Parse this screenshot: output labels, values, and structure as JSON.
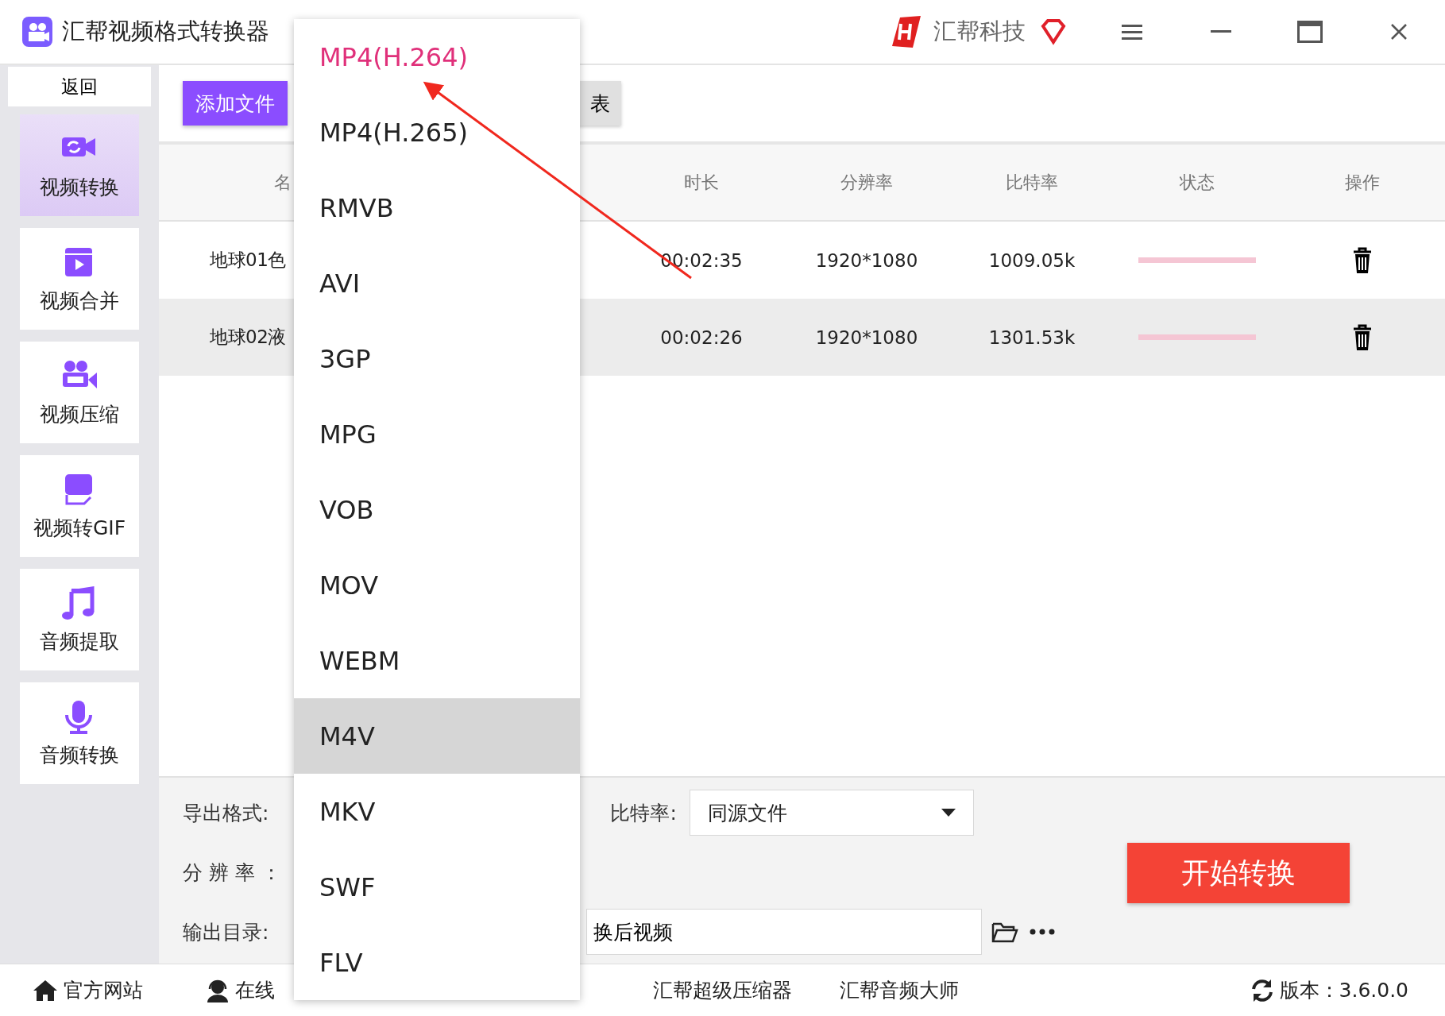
{
  "window": {
    "title": "汇帮视频格式转换器",
    "brand": "汇帮科技"
  },
  "sidebar": {
    "back": "返回",
    "items": [
      {
        "label": "视频转换",
        "selected": true
      },
      {
        "label": "视频合并",
        "selected": false
      },
      {
        "label": "视频压缩",
        "selected": false
      },
      {
        "label": "视频转GIF",
        "selected": false
      },
      {
        "label": "音频提取",
        "selected": false
      },
      {
        "label": "音频转换",
        "selected": false
      }
    ]
  },
  "toolbar": {
    "add_file": "添加文件",
    "list_button": "表"
  },
  "table": {
    "columns": [
      "名",
      "时长",
      "分辨率",
      "比特率",
      "状态",
      "操作"
    ],
    "rows": [
      {
        "name": "地球01色",
        "duration": "00:02:35",
        "resolution": "1920*1080",
        "bitrate": "1009.05k",
        "selected": false
      },
      {
        "name": "地球02液",
        "duration": "00:02:26",
        "resolution": "1920*1080",
        "bitrate": "1301.53k",
        "selected": true
      }
    ]
  },
  "settings": {
    "format_label": "导出格式:",
    "bitrate_label": "比特率:",
    "bitrate_value": "同源文件",
    "resolution_label": "分 辨 率 ：",
    "output_label": "输出目录:",
    "output_value": "换后视频",
    "start": "开始转换"
  },
  "format_menu": [
    {
      "label": "MP4(H.264)",
      "selected": true,
      "hovered": false
    },
    {
      "label": "MP4(H.265)",
      "selected": false,
      "hovered": false
    },
    {
      "label": "RMVB",
      "selected": false,
      "hovered": false
    },
    {
      "label": "AVI",
      "selected": false,
      "hovered": false
    },
    {
      "label": "3GP",
      "selected": false,
      "hovered": false
    },
    {
      "label": "MPG",
      "selected": false,
      "hovered": false
    },
    {
      "label": "VOB",
      "selected": false,
      "hovered": false
    },
    {
      "label": "MOV",
      "selected": false,
      "hovered": false
    },
    {
      "label": "WEBM",
      "selected": false,
      "hovered": false
    },
    {
      "label": "M4V",
      "selected": false,
      "hovered": true
    },
    {
      "label": "MKV",
      "selected": false,
      "hovered": false
    },
    {
      "label": "SWF",
      "selected": false,
      "hovered": false
    },
    {
      "label": "FLV",
      "selected": false,
      "hovered": false
    }
  ],
  "footer": {
    "website": "官方网站",
    "online": "在线",
    "links": [
      "汇帮超级压缩器",
      "汇帮音频大师"
    ],
    "version": "版本：3.6.0.0"
  }
}
